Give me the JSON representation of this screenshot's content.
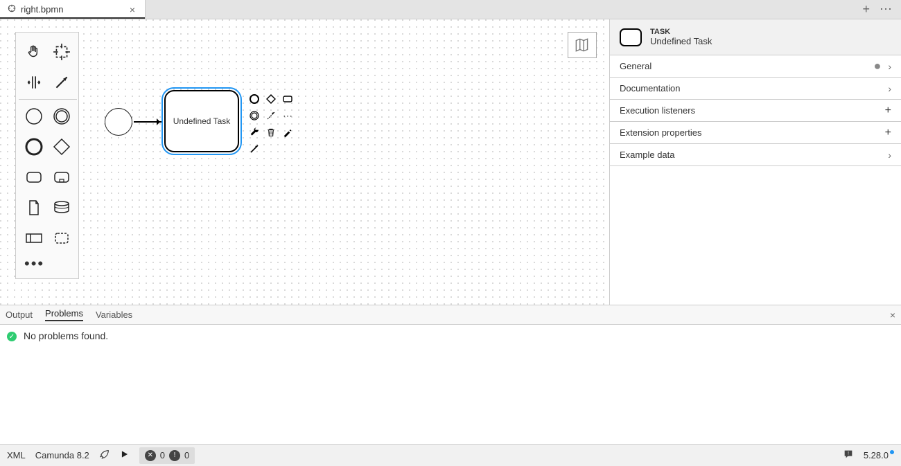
{
  "tab": {
    "filename": "right.bpmn"
  },
  "diagram": {
    "task_label": "Undefined Task"
  },
  "properties_panel": {
    "title": "TASK",
    "subtitle": "Undefined Task",
    "groups": {
      "general": "General",
      "documentation": "Documentation",
      "exec_listeners": "Execution listeners",
      "ext_props": "Extension properties",
      "example_data": "Example data"
    }
  },
  "bottom_panel": {
    "tab_output": "Output",
    "tab_problems": "Problems",
    "tab_variables": "Variables",
    "body": "No problems found."
  },
  "statusbar": {
    "xml": "XML",
    "camunda": "Camunda 8.2",
    "err_count": "0",
    "warn_count": "0",
    "version": "5.28.0"
  },
  "icon_names": {
    "hand": "hand-tool-icon",
    "lasso": "lasso-tool-icon",
    "space": "space-tool-icon",
    "connect": "connect-tool-icon",
    "start_event": "start-event-icon",
    "end_event": "end-event-icon",
    "inter_event": "intermediate-event-icon",
    "gateway": "gateway-icon",
    "task": "task-icon",
    "subprocess": "subprocess-icon",
    "dataobj": "data-object-icon",
    "datastore": "data-store-icon",
    "pool": "pool-icon",
    "group": "group-icon"
  }
}
